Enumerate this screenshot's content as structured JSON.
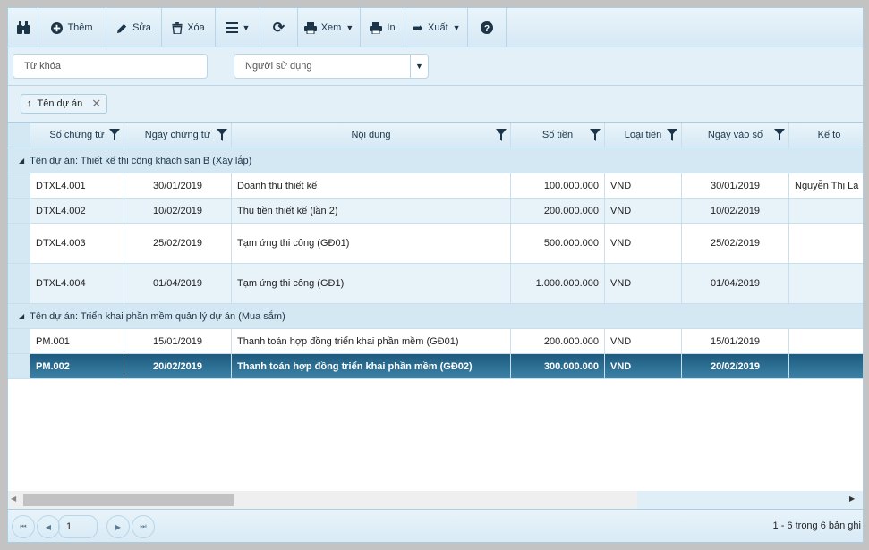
{
  "toolbar": {
    "add": "Thêm",
    "edit": "Sửa",
    "delete": "Xóa",
    "view": "Xem",
    "print": "In",
    "export": "Xuất"
  },
  "filters": {
    "keyword_placeholder": "Từ khóa",
    "user_placeholder": "Người sử dụng"
  },
  "group_chip": {
    "label": "Tên dự án"
  },
  "columns": [
    "Số chứng từ",
    "Ngày chứng từ",
    "Nội dung",
    "Số tiền",
    "Loại tiền",
    "Ngày vào sổ",
    "Kế to"
  ],
  "groups": [
    {
      "label": "Tên dự án: Thiết kế thi công khách sạn B (Xây lắp)",
      "rows": [
        [
          "DTXL4.001",
          "30/01/2019",
          "Doanh thu thiết kế",
          "100.000.000",
          "VND",
          "30/01/2019",
          "Nguyễn Thị La"
        ],
        [
          "DTXL4.002",
          "10/02/2019",
          "Thu tiền thiết kế (lần 2)",
          "200.000.000",
          "VND",
          "10/02/2019",
          ""
        ],
        [
          "DTXL4.003",
          "25/02/2019",
          "Tạm ứng thi công (GĐ01)",
          "500.000.000",
          "VND",
          "25/02/2019",
          ""
        ],
        [
          "DTXL4.004",
          "01/04/2019",
          "Tạm ứng thi công (GĐ1)",
          "1.000.000.000",
          "VND",
          "01/04/2019",
          ""
        ]
      ]
    },
    {
      "label": "Tên dự án: Triển khai phần mềm quản lý dự án (Mua sắm)",
      "rows": [
        [
          "PM.001",
          "15/01/2019",
          "Thanh toán hợp đồng triển khai phần mềm (GĐ01)",
          "200.000.000",
          "VND",
          "15/01/2019",
          ""
        ],
        [
          "PM.002",
          "20/02/2019",
          "Thanh toán hợp đồng triển khai phần mềm (GĐ02)",
          "300.000.000",
          "VND",
          "20/02/2019",
          ""
        ]
      ]
    }
  ],
  "selected_row": "PM.002",
  "pager": {
    "page": "1",
    "summary": "1 - 6 trong 6 bản ghi"
  },
  "colors": {
    "selected": "#1c5a7e",
    "header": "#d6e9f5"
  }
}
